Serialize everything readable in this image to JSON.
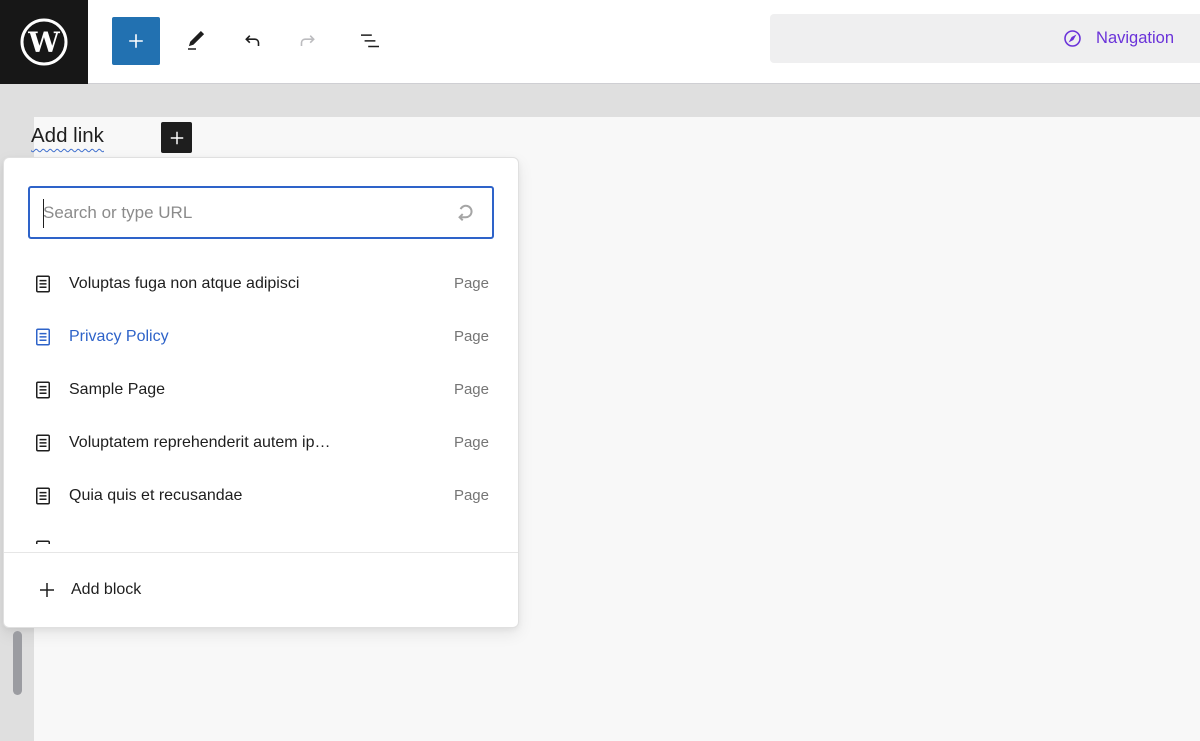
{
  "colors": {
    "accent_blue": "#2e63c9",
    "admin_button_blue": "#2271b1",
    "accent_purple": "#6a32d9",
    "ink": "#1e1e1e",
    "muted_text": "#757575",
    "canvas_frame": "#dfdfdf",
    "canvas_background": "#f8f8f8"
  },
  "header": {
    "logo_icon": "wordpress-logo",
    "toolbar": {
      "inserter_icon": "plus-icon",
      "tools_icon": "pencil-icon",
      "undo_icon": "undo-arrow-icon",
      "redo_icon": "redo-arrow-icon",
      "redo_disabled": true,
      "list_view_icon": "list-view-icon"
    },
    "document_bar": {
      "label": "Navigation",
      "icon": "navigation-compass-icon"
    }
  },
  "canvas": {
    "nav_link_placeholder": "Add link",
    "appender_icon": "plus-icon"
  },
  "link_popover": {
    "search": {
      "placeholder": "Search or type URL",
      "value": "",
      "submit_icon": "enter-return-icon"
    },
    "suggestions": [
      {
        "title": "Voluptas fuga non atque adipisci",
        "type": "Page",
        "icon": "page-icon"
      },
      {
        "title": "Privacy Policy",
        "type": "Page",
        "icon": "page-icon",
        "active": true
      },
      {
        "title": "Sample Page",
        "type": "Page",
        "icon": "page-icon"
      },
      {
        "title": "Voluptatem reprehenderit autem ip…",
        "type": "Page",
        "icon": "page-icon"
      },
      {
        "title": "Quia quis et recusandae",
        "type": "Page",
        "icon": "page-icon"
      },
      {
        "title": "",
        "type": "",
        "icon": "page-icon"
      }
    ],
    "footer": {
      "add_block_label": "Add block",
      "icon": "plus-icon"
    }
  }
}
